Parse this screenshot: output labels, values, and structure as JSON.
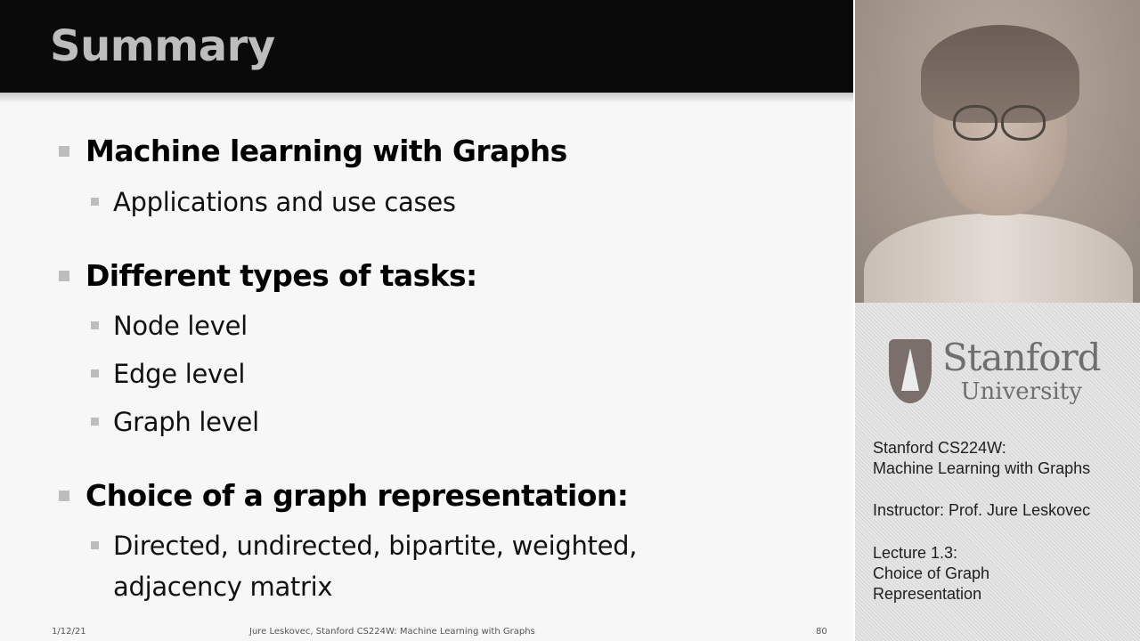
{
  "slide": {
    "title": "Summary",
    "sections": [
      {
        "heading": "Machine learning with Graphs",
        "items": [
          "Applications and use cases"
        ]
      },
      {
        "heading": "Different types of tasks:",
        "items": [
          "Node level",
          "Edge level",
          "Graph level"
        ]
      },
      {
        "heading": "Choice of a graph representation:",
        "items": [
          "Directed, undirected, bipartite, weighted,",
          "adjacency matrix"
        ]
      }
    ],
    "footer": {
      "date": "1/12/21",
      "center": "Jure Leskovec, Stanford CS224W: Machine Learning with Graphs",
      "page": "80"
    }
  },
  "sidebar": {
    "logo": {
      "line1": "Stanford",
      "line2": "University"
    },
    "course": [
      "Stanford CS224W:",
      "Machine Learning with Graphs"
    ],
    "instructor": "Instructor: Prof. Jure Leskovec",
    "lecture": [
      "Lecture 1.3:",
      "Choice of Graph",
      "Representation"
    ]
  }
}
